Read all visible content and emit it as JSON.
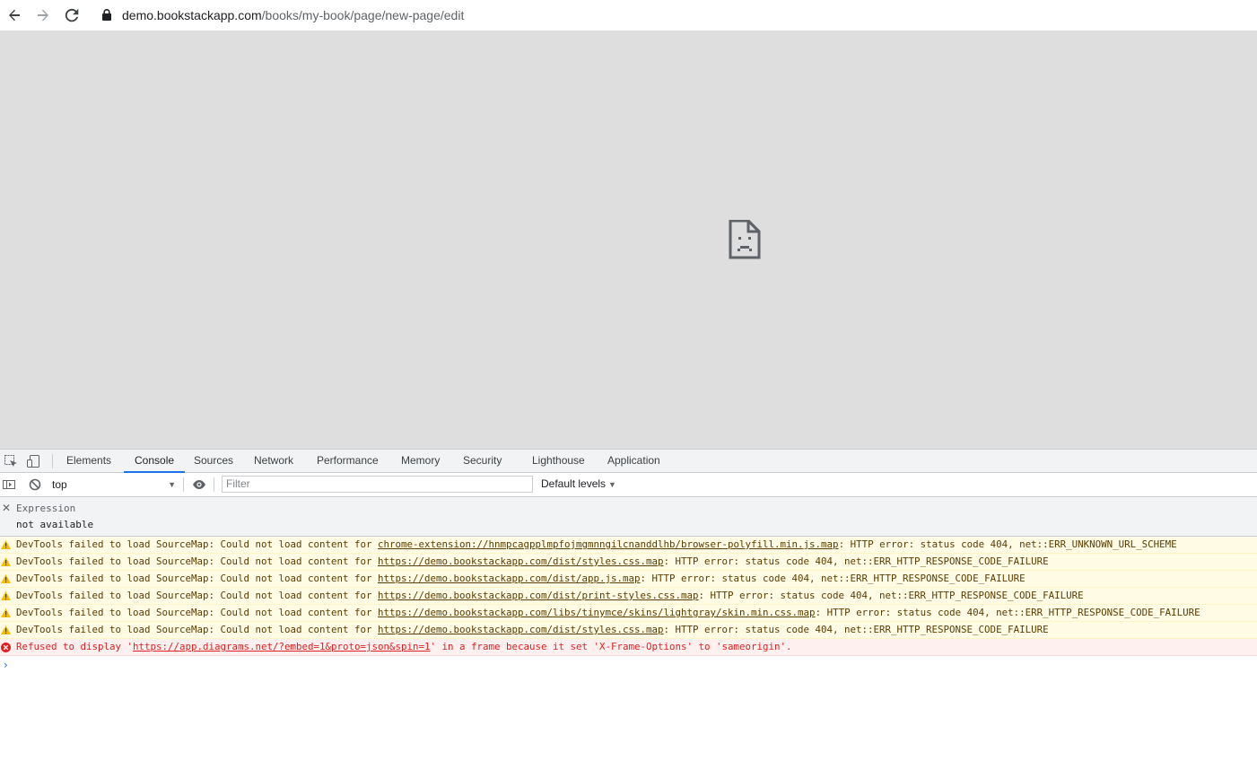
{
  "browser": {
    "url_host": "demo.bookstackapp.com",
    "url_path": "/books/my-book/page/new-page/edit"
  },
  "devtools": {
    "tabs": [
      {
        "label": "Elements"
      },
      {
        "label": "Console"
      },
      {
        "label": "Sources"
      },
      {
        "label": "Network"
      },
      {
        "label": "Performance"
      },
      {
        "label": "Memory"
      },
      {
        "label": "Security"
      },
      {
        "label": "Lighthouse"
      },
      {
        "label": "Application"
      }
    ],
    "active_tab": "Console",
    "console": {
      "context": "top",
      "filter_placeholder": "Filter",
      "levels": "Default levels",
      "expression": {
        "label": "Expression",
        "value": "not available"
      },
      "messages": [
        {
          "level": "warning",
          "prefix": "DevTools failed to load SourceMap: Could not load content for ",
          "link": "chrome-extension://hnmpcagpplmpfojmgmnngilcnanddlhb/browser-polyfill.min.js.map",
          "suffix": ": HTTP error: status code 404, net::ERR_UNKNOWN_URL_SCHEME"
        },
        {
          "level": "warning",
          "prefix": "DevTools failed to load SourceMap: Could not load content for ",
          "link": "https://demo.bookstackapp.com/dist/styles.css.map",
          "suffix": ": HTTP error: status code 404, net::ERR_HTTP_RESPONSE_CODE_FAILURE"
        },
        {
          "level": "warning",
          "prefix": "DevTools failed to load SourceMap: Could not load content for ",
          "link": "https://demo.bookstackapp.com/dist/app.js.map",
          "suffix": ": HTTP error: status code 404, net::ERR_HTTP_RESPONSE_CODE_FAILURE"
        },
        {
          "level": "warning",
          "prefix": "DevTools failed to load SourceMap: Could not load content for ",
          "link": "https://demo.bookstackapp.com/dist/print-styles.css.map",
          "suffix": ": HTTP error: status code 404, net::ERR_HTTP_RESPONSE_CODE_FAILURE"
        },
        {
          "level": "warning",
          "prefix": "DevTools failed to load SourceMap: Could not load content for ",
          "link": "https://demo.bookstackapp.com/libs/tinymce/skins/lightgray/skin.min.css.map",
          "suffix": ": HTTP error: status code 404, net::ERR_HTTP_RESPONSE_CODE_FAILURE"
        },
        {
          "level": "warning",
          "prefix": "DevTools failed to load SourceMap: Could not load content for ",
          "link": "https://demo.bookstackapp.com/dist/styles.css.map",
          "suffix": ": HTTP error: status code 404, net::ERR_HTTP_RESPONSE_CODE_FAILURE"
        },
        {
          "level": "error",
          "prefix": "Refused to display '",
          "link": "https://app.diagrams.net/?embed=1&proto=json&spin=1",
          "suffix": "' in a frame because it set 'X-Frame-Options' to 'sameorigin'."
        }
      ],
      "prompt_symbol": "›"
    }
  },
  "colors": {
    "accent": "#1a73e8",
    "warning_bg": "#fffbe5",
    "warning_text": "#5c3c00",
    "error_bg": "#fff0f0",
    "error_text": "#e41e1e",
    "page_bg": "#dedede"
  }
}
